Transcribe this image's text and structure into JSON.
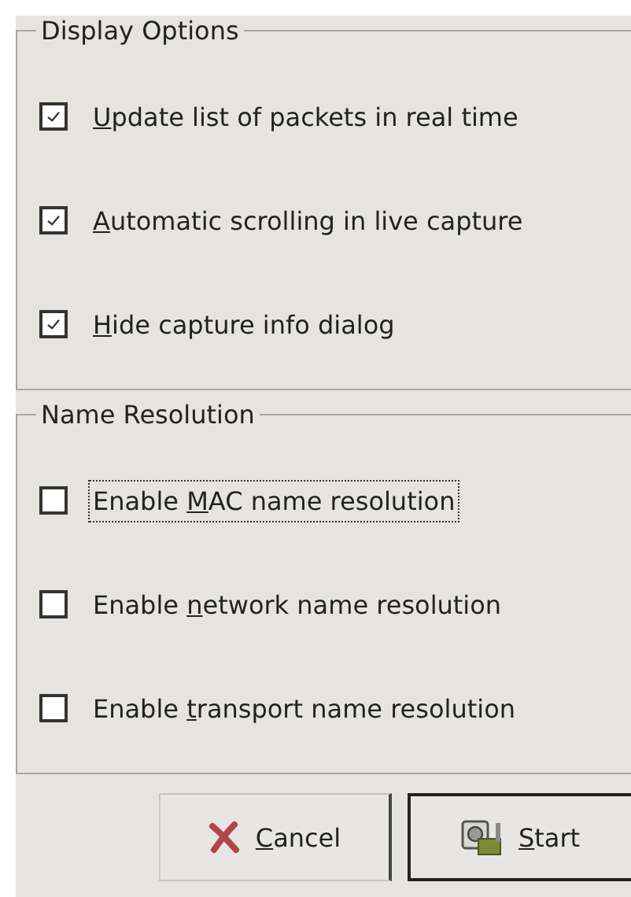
{
  "frames": [
    {
      "title": "Display Options",
      "options": [
        {
          "label": {
            "key": "U",
            "after": "pdate list of packets in real time"
          },
          "checked": true,
          "focused": false
        },
        {
          "label": {
            "key": "A",
            "after": "utomatic scrolling in live capture"
          },
          "checked": true,
          "focused": false
        },
        {
          "label": {
            "key": "H",
            "after": "ide capture info dialog"
          },
          "checked": true,
          "focused": false
        }
      ]
    },
    {
      "title": "Name Resolution",
      "options": [
        {
          "label": {
            "before": "Enable ",
            "key": "M",
            "after": "AC name resolution"
          },
          "checked": false,
          "focused": true
        },
        {
          "label": {
            "before": "Enable ",
            "key": "n",
            "after": "etwork name resolution"
          },
          "checked": false,
          "focused": false
        },
        {
          "label": {
            "before": "Enable ",
            "key": "t",
            "after": "ransport name resolution"
          },
          "checked": false,
          "focused": false
        }
      ]
    }
  ],
  "buttons": [
    {
      "kind": "cancel",
      "label": {
        "key": "C",
        "after": "ancel"
      },
      "default": false
    },
    {
      "kind": "start",
      "label": {
        "key": "S",
        "after": "tart"
      },
      "default": true
    }
  ]
}
